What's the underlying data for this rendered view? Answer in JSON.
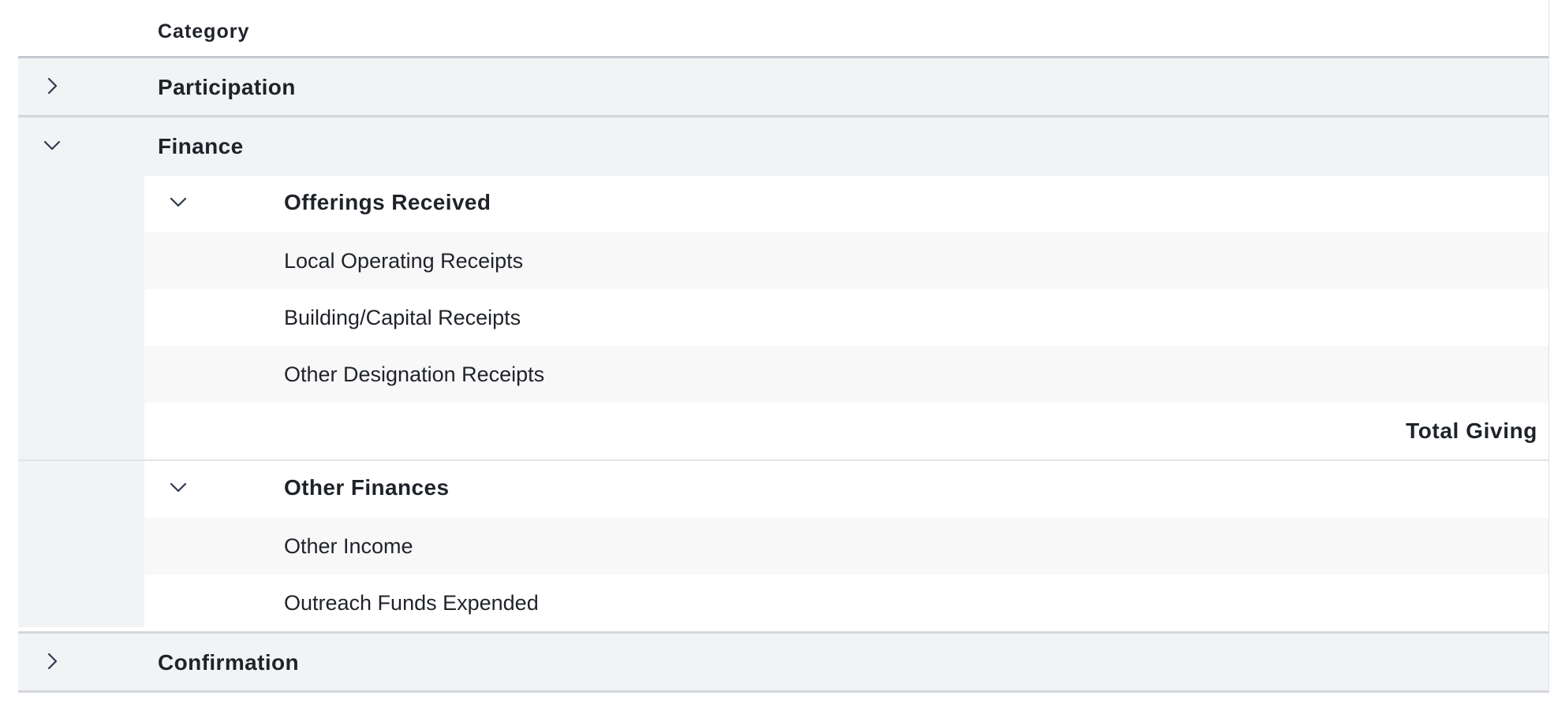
{
  "table": {
    "column_header": "Category",
    "groups": [
      {
        "label": "Participation",
        "expanded": false,
        "icon": "chevron-right-icon"
      },
      {
        "label": "Finance",
        "expanded": true,
        "icon": "chevron-down-icon",
        "subgroups": [
          {
            "label": "Offerings Received",
            "expanded": true,
            "icon": "chevron-down-icon",
            "items": [
              "Local Operating Receipts",
              "Building/Capital Receipts",
              "Other Designation Receipts"
            ],
            "total_label": "Total Giving"
          },
          {
            "label": "Other Finances",
            "expanded": true,
            "icon": "chevron-down-icon",
            "items": [
              "Other Income",
              "Outreach Funds Expended"
            ]
          }
        ]
      },
      {
        "label": "Confirmation",
        "expanded": false,
        "icon": "chevron-right-icon"
      }
    ]
  }
}
